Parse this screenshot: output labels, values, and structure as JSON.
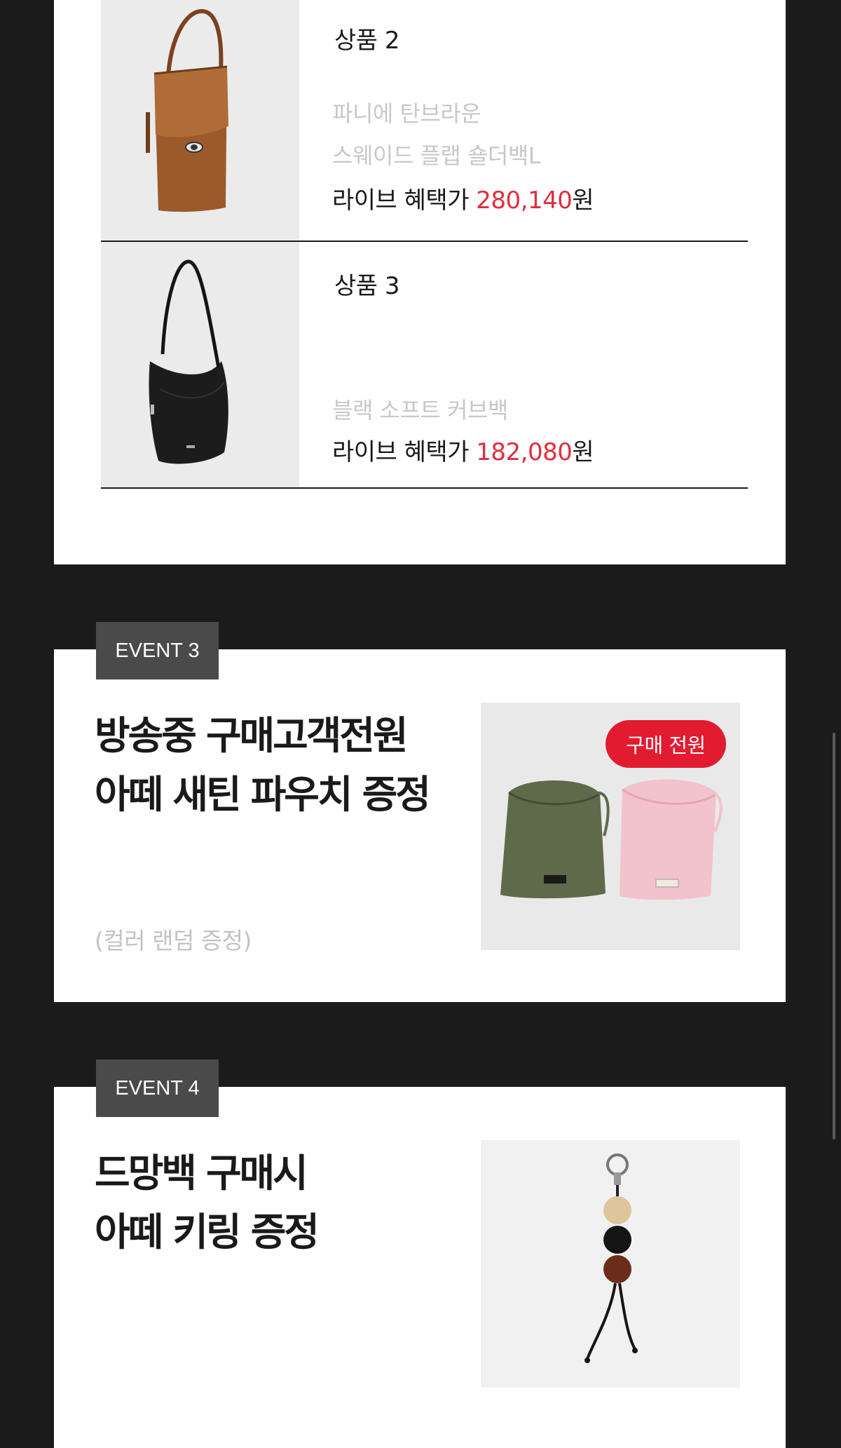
{
  "products": [
    {
      "label": "상품 2",
      "name_lines": [
        "파니에 탄브라운",
        "스웨이드 플랩 숄더백L"
      ],
      "price_prefix": "라이브 혜택가 ",
      "price": "280,140",
      "price_suffix": "원",
      "image_icon": "brown-suede-bag-image"
    },
    {
      "label": "상품 3",
      "name_lines": [
        "블랙 소프트 커브백"
      ],
      "price_prefix": "라이브 혜택가 ",
      "price": "182,080",
      "price_suffix": "원",
      "image_icon": "black-curve-bag-image"
    }
  ],
  "event3": {
    "tag": "EVENT 3",
    "headline_lines": [
      "방송중 구매고객전원",
      "아떼 새틴 파우치 증정"
    ],
    "note": "(컬러 랜덤 증정)",
    "badge": "구매 전원",
    "image_icon": "satin-pouch-image"
  },
  "event4": {
    "tag": "EVENT 4",
    "headline_lines": [
      "드망백 구매시",
      "아떼 키링 증정"
    ],
    "image_icon": "keyring-image"
  },
  "colors": {
    "background": "#1b1b1b",
    "card": "#ffffff",
    "price_accent": "#e02d3c",
    "badge": "#e21b31",
    "tag": "#4a4a4a"
  }
}
